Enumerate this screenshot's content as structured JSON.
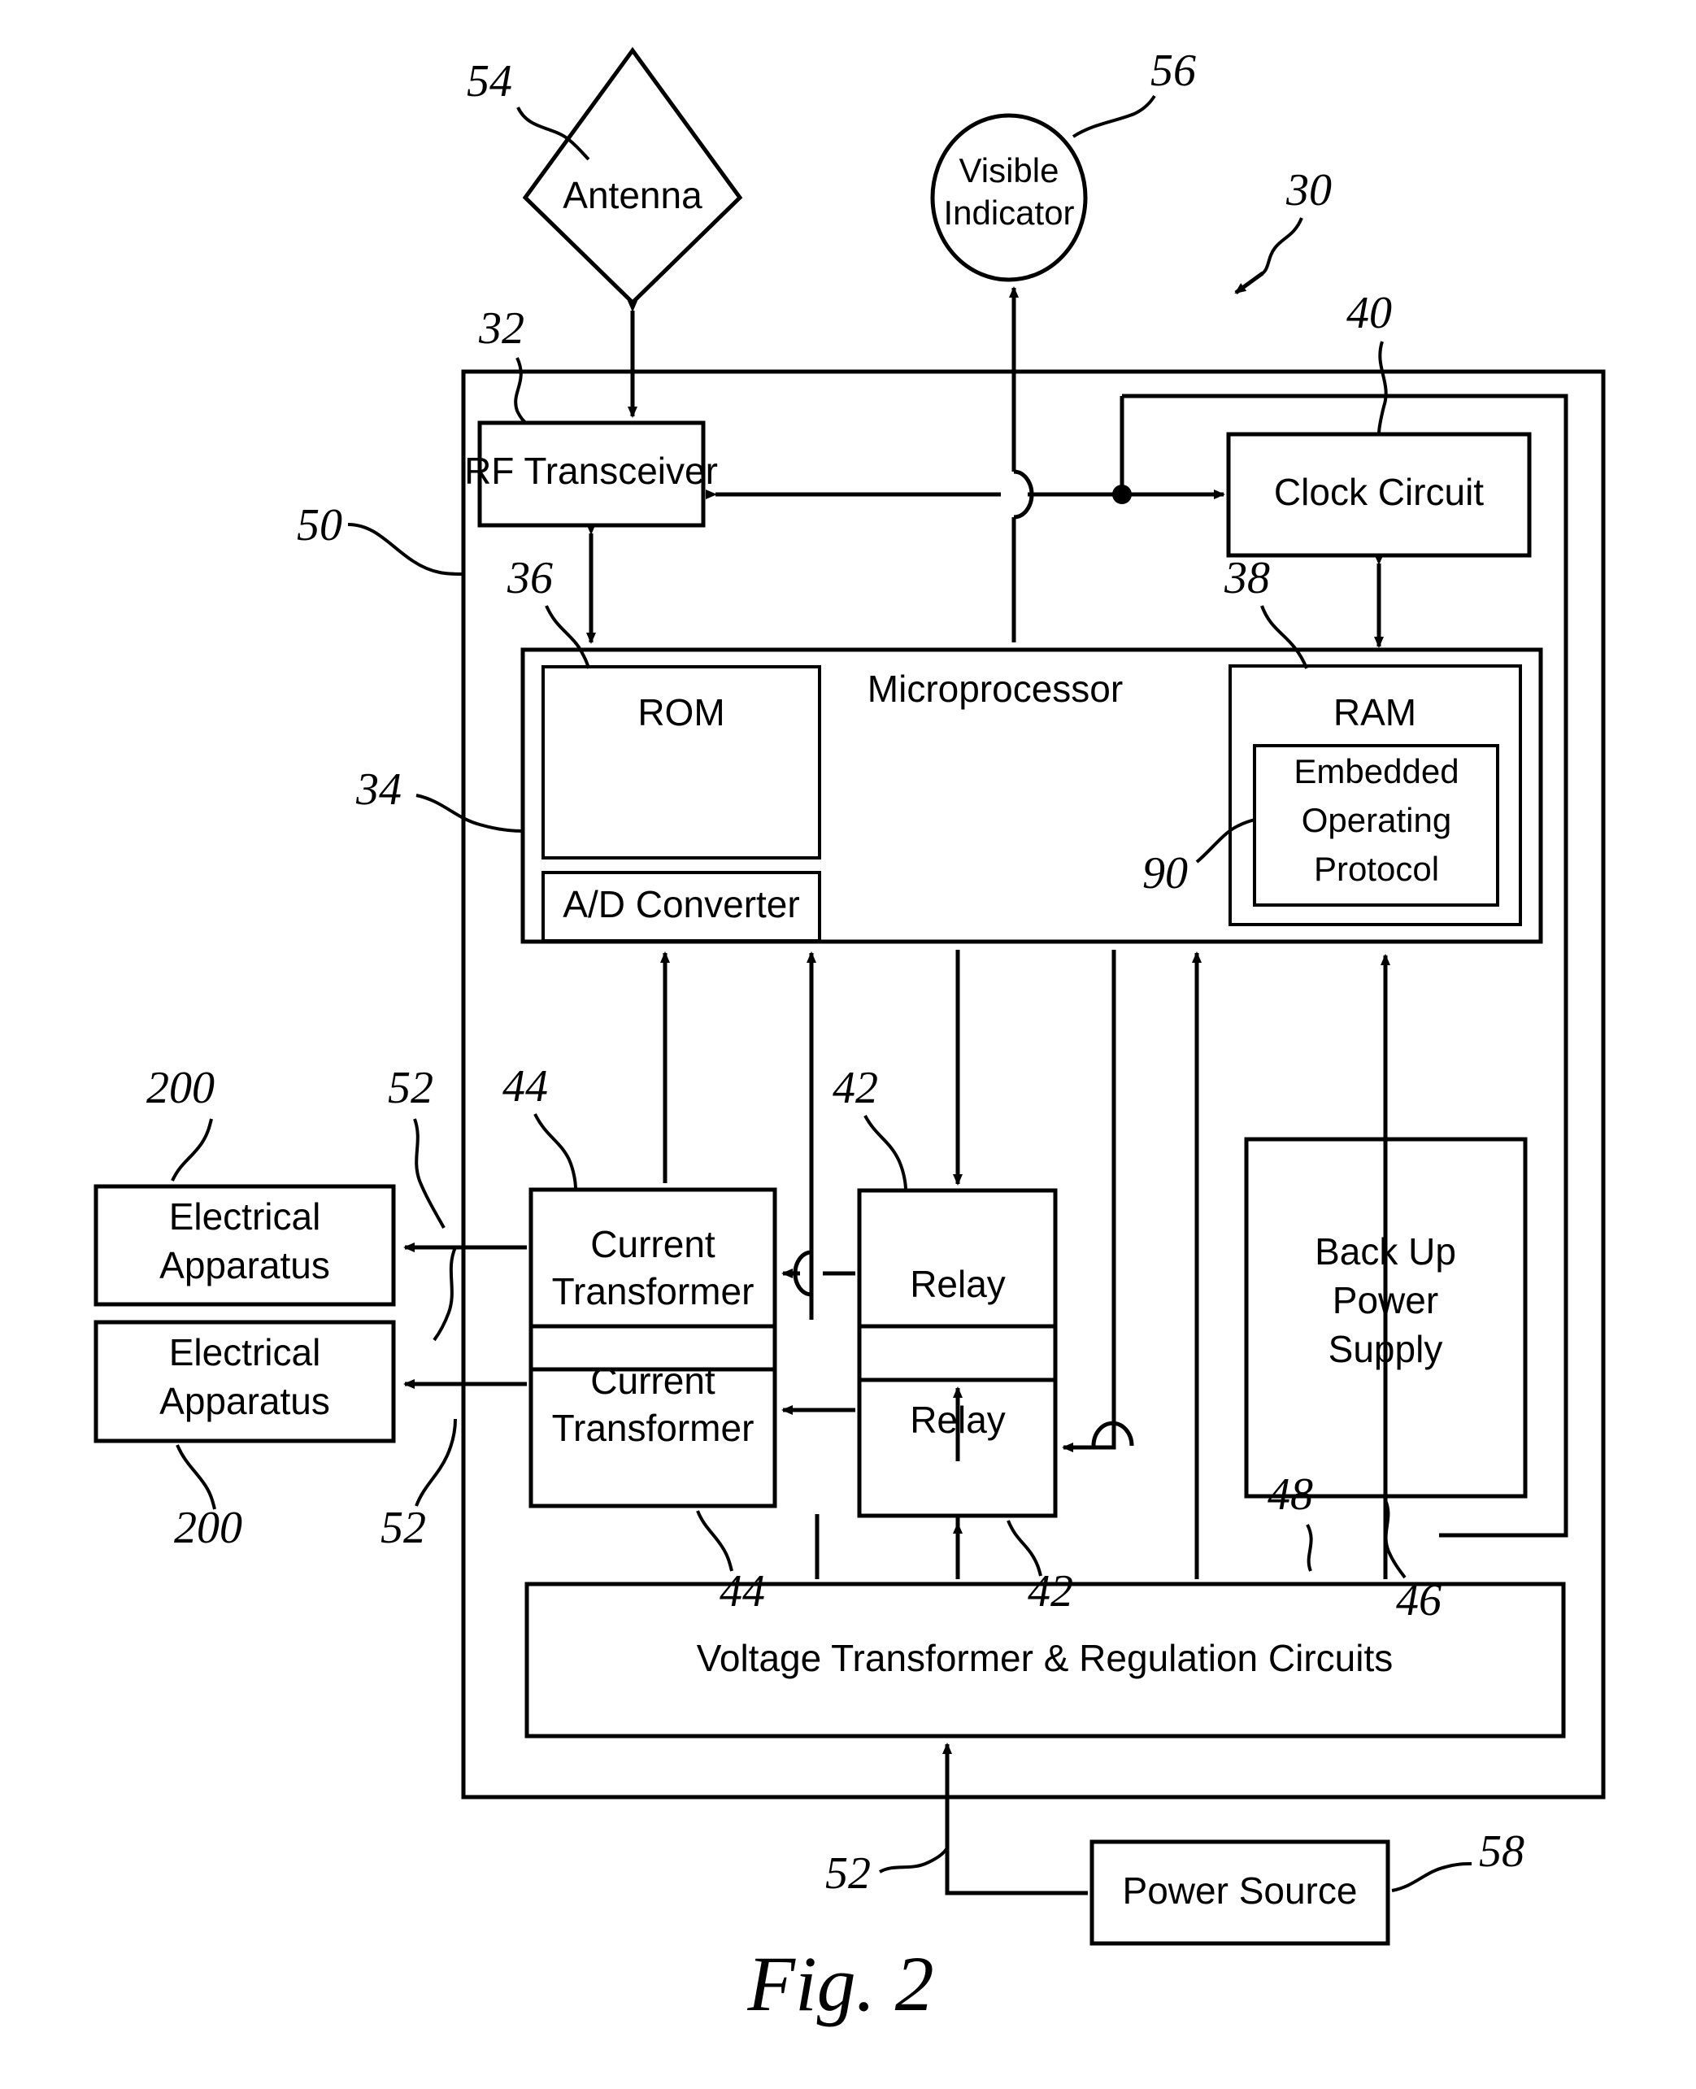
{
  "figure": {
    "caption": "Fig. 2",
    "system_ref": "30"
  },
  "blocks": {
    "antenna": {
      "label": "Antenna",
      "ref": "54",
      "shape": "diamond"
    },
    "visible_indicator": {
      "label_line1": "Visible",
      "label_line2": "Indicator",
      "ref": "56",
      "shape": "circle"
    },
    "rf_transceiver": {
      "label": "RF Transceiver",
      "ref": "32"
    },
    "clock_circuit": {
      "label": "Clock Circuit",
      "ref": "40"
    },
    "microprocessor": {
      "label": "Microprocessor",
      "ref": "34"
    },
    "rom": {
      "label": "ROM",
      "ref": "36"
    },
    "ad_converter": {
      "label": "A/D Converter"
    },
    "ram": {
      "label": "RAM",
      "ref": "38"
    },
    "embedded_operating_protocol": {
      "label_line1": "Embedded",
      "label_line2": "Operating",
      "label_line3": "Protocol",
      "ref": "90"
    },
    "current_transformer_top": {
      "label_line1": "Current",
      "label_line2": "Transformer",
      "ref": "44"
    },
    "current_transformer_bottom": {
      "label_line1": "Current",
      "label_line2": "Transformer",
      "ref": "44"
    },
    "relay_top": {
      "label": "Relay",
      "ref": "42"
    },
    "relay_bottom": {
      "label": "Relay",
      "ref": "42"
    },
    "backup_power_supply": {
      "label_line1": "Back Up",
      "label_line2": "Power",
      "label_line3": "Supply",
      "ref": "46"
    },
    "electrical_apparatus_top": {
      "label_line1": "Electrical",
      "label_line2": "Apparatus",
      "ref": "200"
    },
    "electrical_apparatus_bottom": {
      "label_line1": "Electrical",
      "label_line2": "Apparatus",
      "ref": "200"
    },
    "voltage_transformer": {
      "label": "Voltage Transformer & Regulation Circuits",
      "ref": "48"
    },
    "power_source": {
      "label": "Power Source",
      "ref": "58"
    },
    "enclosure": {
      "ref": "50"
    }
  },
  "line_refs": {
    "conductor_top": "52",
    "conductor_bottom": "52",
    "conductor_mains": "52"
  },
  "colors": {
    "ink": "#000000",
    "paper": "#ffffff"
  }
}
